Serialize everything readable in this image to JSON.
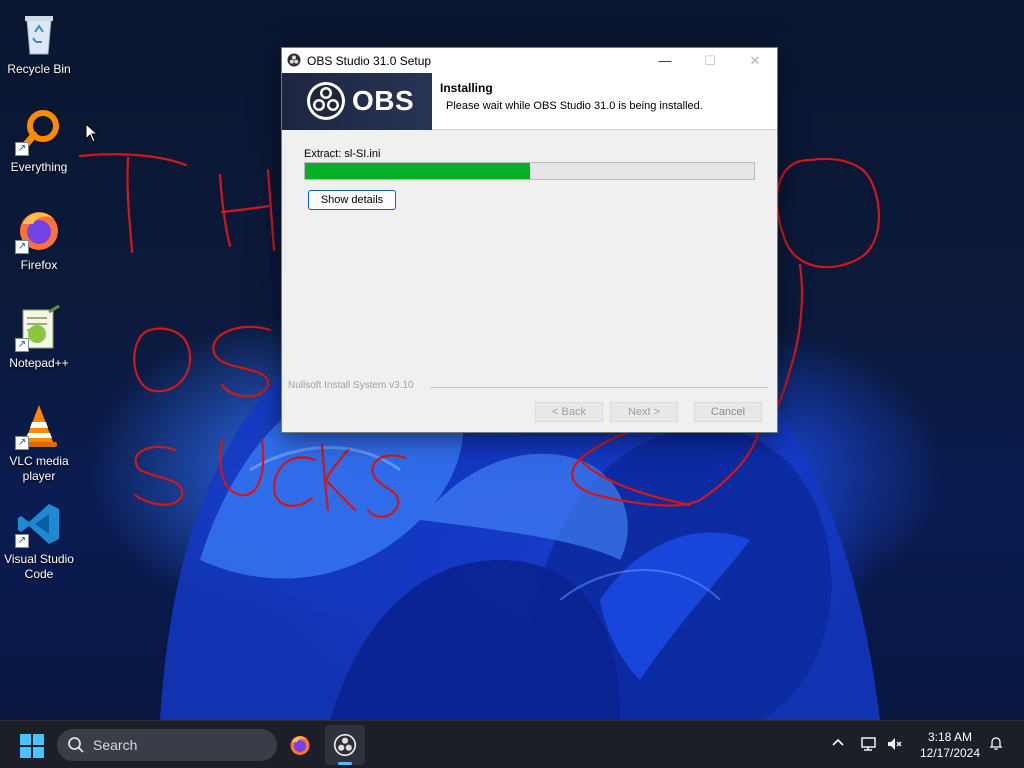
{
  "desktop": {
    "icons": [
      {
        "label": "Recycle Bin",
        "icon": "recycle-bin-icon"
      },
      {
        "label": "Everything",
        "icon": "everything-search-icon"
      },
      {
        "label": "Firefox",
        "icon": "firefox-icon"
      },
      {
        "label": "Notepad++",
        "icon": "notepad-plus-plus-icon"
      },
      {
        "label": "VLC media player",
        "icon": "vlc-icon"
      },
      {
        "label": "Visual Studio Code",
        "icon": "vscode-icon"
      }
    ],
    "annotation_text": "THE OBS SUCKS"
  },
  "dialog": {
    "title": "OBS Studio 31.0 Setup",
    "banner_text": "OBS",
    "header_title": "Installing",
    "header_subtitle": "Please wait while OBS Studio 31.0 is being installed.",
    "extract_label": "Extract: sl-SI.ini",
    "progress_fraction": 0.5,
    "show_details_label": "Show details",
    "brand_line": "Nullsoft Install System v3.10",
    "back_label": "< Back",
    "next_label": "Next >",
    "cancel_label": "Cancel",
    "minimize_glyph": "—",
    "maximize_glyph": "☐",
    "close_glyph": "✕"
  },
  "taskbar": {
    "search_label": "Search",
    "time": "3:18 AM",
    "date": "12/17/2024",
    "apps": [
      "firefox-icon",
      "obs-icon"
    ],
    "active_color": "#4cc2ff"
  },
  "colors": {
    "progress_fill": "#06b025",
    "scribble": "#d01818",
    "accent": "#0067c0"
  }
}
